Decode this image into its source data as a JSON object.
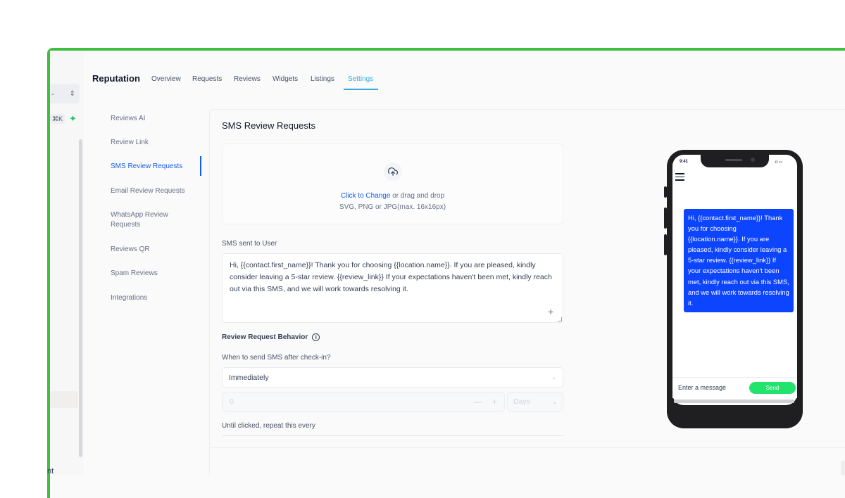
{
  "app": {
    "title": "Reputation",
    "tabs": [
      {
        "label": "Overview",
        "active": false
      },
      {
        "label": "Requests",
        "active": false
      },
      {
        "label": "Reviews",
        "active": false
      },
      {
        "label": "Widgets",
        "active": false
      },
      {
        "label": "Listings",
        "active": false
      },
      {
        "label": "Settings",
        "active": true
      }
    ]
  },
  "left_strip": {
    "select_value": "-",
    "shortcut": "⌘K",
    "bottom_text": "nt"
  },
  "sidebar": {
    "items": [
      {
        "label": "Reviews AI",
        "active": false
      },
      {
        "label": "Review Link",
        "active": false
      },
      {
        "label": "SMS Review Requests",
        "active": true
      },
      {
        "label": "Email Review Requests",
        "active": false
      },
      {
        "label": "WhatsApp Review Requests",
        "active": false
      },
      {
        "label": "Reviews QR",
        "active": false
      },
      {
        "label": "Spam Reviews",
        "active": false
      },
      {
        "label": "Integrations",
        "active": false
      }
    ]
  },
  "main": {
    "title": "SMS Review Requests",
    "upload": {
      "link_text": "Click to Change",
      "rest_text": " or drag and drop",
      "hint": "SVG, PNG or JPG(max. 16x16px)",
      "icon": "upload-cloud-icon"
    },
    "sms_label": "SMS sent to User",
    "sms_text": "Hi, {{contact.first_name}}! Thank you for choosing {{location.name}}. If you are pleased, kindly consider leaving a 5-star review. {{review_link}} If your expectations haven't been met, kindly reach out via this SMS, and we will work towards resolving it.",
    "behavior_heading": "Review Request Behavior",
    "when_label": "When to send SMS after check-in?",
    "when_value": "Immediately",
    "delay_value": "0",
    "delay_unit": "Days",
    "repeat_label": "Until clicked, repeat this every"
  },
  "preview": {
    "time": "9:41",
    "status": "·ıl ▭",
    "bubble_text": "Hi, {{contact.first_name}}! Thank you for choosing {{location.name}}. If you are pleased, kindly consider leaving a 5-star review. {{review_link}} If your expectations haven't been met, kindly reach out via this SMS, and we will work towards resolving it.",
    "input_placeholder": "Enter a message",
    "send_label": "Send"
  },
  "colors": {
    "frame_border": "#3fbe3f",
    "accent_blue": "#155eef",
    "tab_active": "#38a9d8",
    "bubble": "#0d45ff",
    "send_button": "#22e36b"
  }
}
